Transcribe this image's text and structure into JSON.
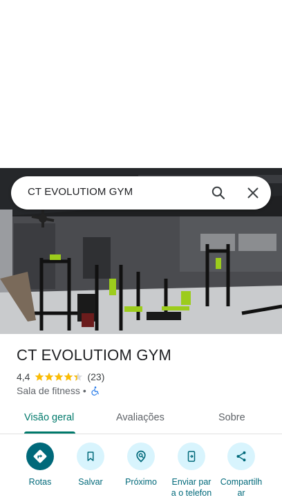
{
  "search": {
    "query": "CT EVOLUTIOM GYM"
  },
  "place": {
    "title": "CT EVOLUTIOM GYM",
    "rating": "4,4",
    "stars_filled": 4.4,
    "reviews_count": "(23)",
    "category": "Sala de fitness",
    "separator": "•",
    "accessibility_icon": "wheelchair-icon"
  },
  "tabs": [
    {
      "label": "Visão geral",
      "active": true
    },
    {
      "label": "Avaliações",
      "active": false
    },
    {
      "label": "Sobre",
      "active": false
    }
  ],
  "actions": [
    {
      "label": "Rotas",
      "icon": "directions-icon",
      "primary": true
    },
    {
      "label": "Salvar",
      "icon": "bookmark-icon",
      "primary": false
    },
    {
      "label": "Próximo",
      "icon": "nearby-icon",
      "primary": false
    },
    {
      "label": "Enviar para o telefone",
      "icon": "send-to-phone-icon",
      "primary": false
    },
    {
      "label": "Compartilhar",
      "icon": "share-icon",
      "primary": false
    }
  ],
  "colors": {
    "accent": "#00796b",
    "action_primary": "#00697a",
    "action_secondary_bg": "#d8f4fd",
    "star": "#fbbc04"
  }
}
